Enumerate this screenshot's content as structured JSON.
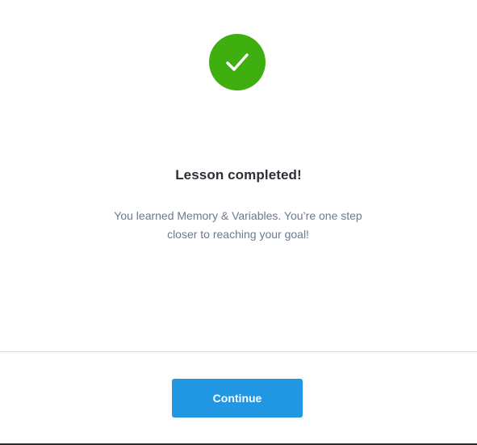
{
  "dialog": {
    "icon": "checkmark-icon",
    "success_color": "#3fae0f",
    "title": "Lesson completed!",
    "message": "You learned Memory & Variables. You’re one step closer to reaching your goal!",
    "continue_label": "Continue",
    "button_color": "#2196e3"
  }
}
